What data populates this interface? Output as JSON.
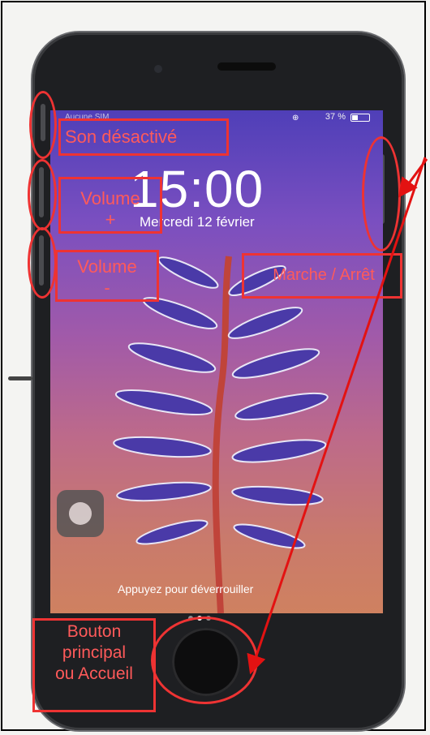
{
  "status_bar": {
    "carrier": "Aucune SIM",
    "battery": "37 %"
  },
  "lock_screen": {
    "time": "15:00",
    "date": "Mercredi 12 février",
    "unlock_hint": "Appuyez pour déverrouiller"
  },
  "annotations": {
    "mute": "Son désactivé",
    "volume_up_line1": "Volume",
    "volume_up_line2": "+",
    "volume_down_line1": "Volume",
    "volume_down_line2": "-",
    "power": "Marche / Arrêt",
    "home_line1": "Bouton",
    "home_line2": "principal",
    "home_line3": "ou Accueil"
  },
  "colors": {
    "annotation": "#e33333",
    "phone_body": "#1e1f22"
  },
  "icons": {
    "home_button": "home-button",
    "lock": "lock-rotation-icon",
    "battery": "battery-icon"
  }
}
